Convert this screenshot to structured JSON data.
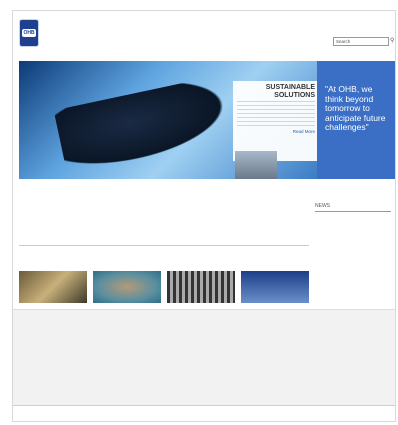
{
  "header": {
    "logo_text": "OHB",
    "tagline": "",
    "utility_links": "",
    "search_placeholder": "Search"
  },
  "nav": {
    "items": []
  },
  "hero": {
    "promo_title": "SUSTAINABLE SOLUTIONS",
    "promo_more": "Read More",
    "quote": "\"At OHB, we think beyond tomorrow to anticipate future challenges\""
  },
  "intro_text": "",
  "categories": [],
  "news": {
    "title": "NEWS",
    "items": []
  },
  "footer": {
    "columns": []
  },
  "bottom_bar": ""
}
